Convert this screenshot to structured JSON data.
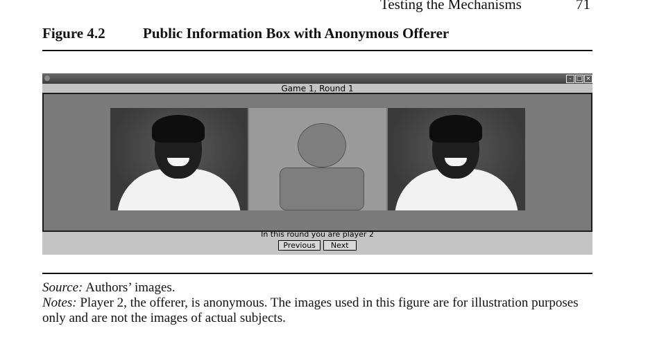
{
  "header": {
    "running_head": "Testing the Mechanisms",
    "page_number": "71"
  },
  "figure": {
    "label": "Figure 4.2",
    "title": "Public Information Box with Anonymous Offerer"
  },
  "screenshot": {
    "window_title": "",
    "game_heading": "Game 1, Round 1",
    "status_text": "In this round you are player 2",
    "buttons": {
      "previous": "Previous",
      "next": "Next"
    },
    "window_controls": {
      "minimize": "-",
      "maximize": "□",
      "close": "×"
    }
  },
  "captions": {
    "source_label": "Source:",
    "source_text": "Authors’ images.",
    "notes_label": "Notes:",
    "notes_text": "Player 2, the offerer, is anonymous. The images used in this figure are for illustration purposes only and are not the images of actual subjects."
  }
}
